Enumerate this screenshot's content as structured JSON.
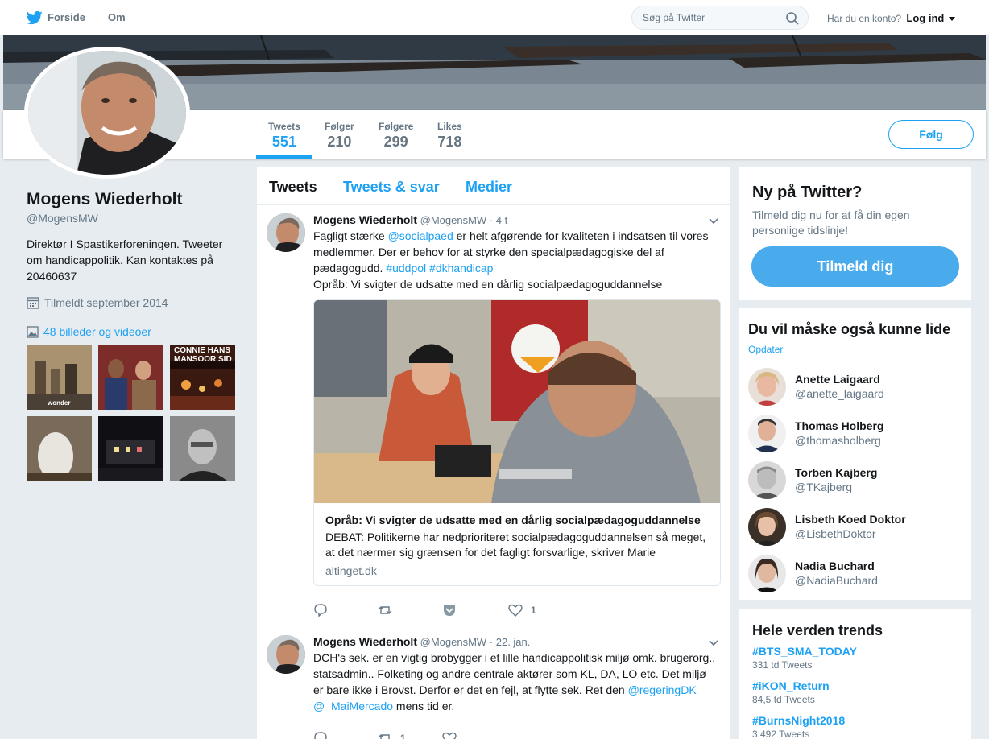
{
  "nav": {
    "home_label": "Forside",
    "about_label": "Om",
    "search_placeholder": "Søg på Twitter",
    "account_prompt": "Har du en konto?",
    "login_label": "Log ind"
  },
  "profile": {
    "name": "Mogens Wiederholt",
    "handle": "@MogensMW",
    "bio": "Direktør I Spastikerforeningen. Tweeter om handicappolitik. Kan kontaktes på 20460637",
    "joined": "Tilmeldt september 2014",
    "photos_link": "48 billeder og videoer",
    "follow_label": "Følg",
    "thumb_texts": [
      "wonder",
      "CONNIE HANS MANSOOR SID"
    ]
  },
  "stats": [
    {
      "label": "Tweets",
      "value": "551"
    },
    {
      "label": "Følger",
      "value": "210"
    },
    {
      "label": "Følgere",
      "value": "299"
    },
    {
      "label": "Likes",
      "value": "718"
    }
  ],
  "timeline_tabs": [
    "Tweets",
    "Tweets & svar",
    "Medier"
  ],
  "tweets": [
    {
      "name": "Mogens Wiederholt",
      "handle": "@MogensMW",
      "time": "· 4 t",
      "text_parts": [
        "Fagligt stærke ",
        "@socialpaed",
        " er helt afgørende for kvaliteten i indsatsen til vores medlemmer. Der er behov for at styrke den specialpædagogiske del af pædagogudd. ",
        "#uddpol",
        " ",
        "#dkhandicap"
      ],
      "text_line2": "Opråb: Vi svigter de udsatte med en dårlig socialpædagoguddannelse",
      "card": {
        "title": "Opråb: Vi svigter de udsatte med en dårlig socialpædagoguddannelse",
        "description": "DEBAT: Politikerne har nedprioriteret socialpædagoguddannelsen så meget, at det nærmer sig grænsen for det fagligt forsvarlige, skriver Marie",
        "domain": "altinget.dk"
      },
      "likes": "1",
      "retweets": ""
    },
    {
      "name": "Mogens Wiederholt",
      "handle": "@MogensMW",
      "time": "· 22. jan.",
      "text_parts": [
        "DCH's sek. er en vigtig brobygger i et lille handicappolitisk miljø omk. brugerorg., statsadmin.. Folketing og andre centrale aktører som KL, DA, LO etc. Det miljø er bare ikke i Brovst. Derfor er det en fejl, at flytte sek. Ret den ",
        "@regeringDK",
        " ",
        "@_MaiMercado",
        " mens tid er."
      ],
      "likes": "",
      "retweets": "1"
    }
  ],
  "signup": {
    "title": "Ny på Twitter?",
    "text": "Tilmeld dig nu for at få din egen personlige tidslinje!",
    "button": "Tilmeld dig"
  },
  "who_to_follow": {
    "title": "Du vil måske også kunne lide",
    "refresh": "Opdater",
    "users": [
      {
        "name": "Anette Laigaard",
        "handle": "@anette_laigaard"
      },
      {
        "name": "Thomas Holberg",
        "handle": "@thomasholberg"
      },
      {
        "name": "Torben Kajberg",
        "handle": "@TKajberg"
      },
      {
        "name": "Lisbeth Koed Doktor",
        "handle": "@LisbethDoktor"
      },
      {
        "name": "Nadia Buchard",
        "handle": "@NadiaBuchard"
      }
    ]
  },
  "trends": {
    "title": "Hele verden trends",
    "items": [
      {
        "tag": "#BTS_SMA_TODAY",
        "count": "331 td Tweets"
      },
      {
        "tag": "#iKON_Return",
        "count": "84,5 td Tweets"
      },
      {
        "tag": "#BurnsNight2018",
        "count": "3.492 Tweets"
      }
    ]
  },
  "colors": {
    "accent": "#1da1f2",
    "background": "#e6ecf0"
  }
}
